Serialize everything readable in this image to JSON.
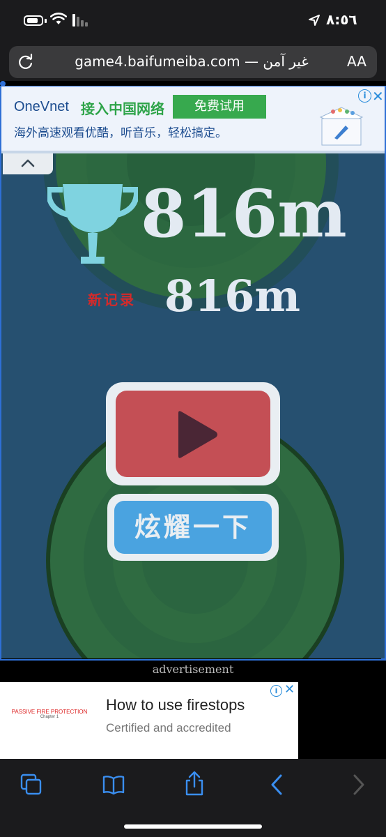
{
  "status": {
    "time": "٨:٥٦"
  },
  "browser": {
    "url": "game4.baifumeiba.com — غير آمن",
    "text_size": "AA"
  },
  "top_ad": {
    "brand": "OneVnet",
    "headline": "接入中国网络",
    "cta": "免费试用",
    "tagline": "海外高速观看优酷，听音乐，轻松搞定。",
    "info": "i",
    "close": "✕"
  },
  "game": {
    "score": "816m",
    "best_score": "816m",
    "new_record_label": "新记录",
    "share_label": "炫耀一下",
    "colors": {
      "background": "#265070",
      "play": "#c44f55",
      "share": "#4aa3e0",
      "record": "#d42a2a",
      "trophy": "#7fd3e0"
    }
  },
  "bottom_ad": {
    "label": "advertisement",
    "thumb_text": "PASSIVE FIRE PROTECTION",
    "thumb_sub": "Chapter 1",
    "title": "How to use firestops",
    "subtitle": "Certified and accredited",
    "info": "i",
    "close": "✕"
  }
}
